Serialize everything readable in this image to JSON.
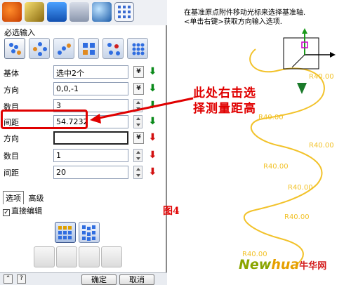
{
  "panel": {
    "section_title": "必选输入",
    "rows": [
      {
        "label": "基体",
        "value": "选中2个",
        "arrow": "⬇",
        "arrow_color": "green",
        "has_spin": false
      },
      {
        "label": "方向",
        "value": "0,0,-1",
        "arrow": "⬇",
        "arrow_color": "green",
        "has_spin": false
      },
      {
        "label": "数目",
        "value": "3",
        "arrow": "⬇",
        "arrow_color": "green",
        "has_spin": true
      },
      {
        "label": "间距",
        "value": "54.7232",
        "arrow": "⬇",
        "arrow_color": "green",
        "has_spin": true
      },
      {
        "label": "方向",
        "value": "",
        "arrow": "⬇",
        "arrow_color": "red",
        "has_spin": false
      },
      {
        "label": "数目",
        "value": "1",
        "arrow": "⬇",
        "arrow_color": "red",
        "has_spin": true
      },
      {
        "label": "间距",
        "value": "20",
        "arrow": "⬇",
        "arrow_color": "red",
        "has_spin": true
      }
    ],
    "tabs": [
      "选项",
      "高级"
    ],
    "checkbox_label": "直接编辑",
    "ok_label": "确定",
    "cancel_label": "取消",
    "dbl_glyph": "¥"
  },
  "viewport": {
    "hint_line1": "在基准原点附件移动光标来选择基准轴.",
    "hint_line2": "<单击右键>获取方向输入选项.",
    "dimension_labels": [
      "R40.00",
      "R40.00",
      "R40.00",
      "R40.00",
      "R40.00",
      "R40.00",
      "R40.00"
    ]
  },
  "annotation": {
    "callout_line1": "此处右击选",
    "callout_line2": "择测量距高",
    "figure_label": "图4",
    "color": "#e00000"
  },
  "watermark": {
    "part1": "New",
    "part2": "hua",
    "part3": "牛华网"
  },
  "colors": {
    "spiral": "#f2c22a",
    "axis_green": "#1a9a1a",
    "axis_magenta": "#cc00cc"
  }
}
